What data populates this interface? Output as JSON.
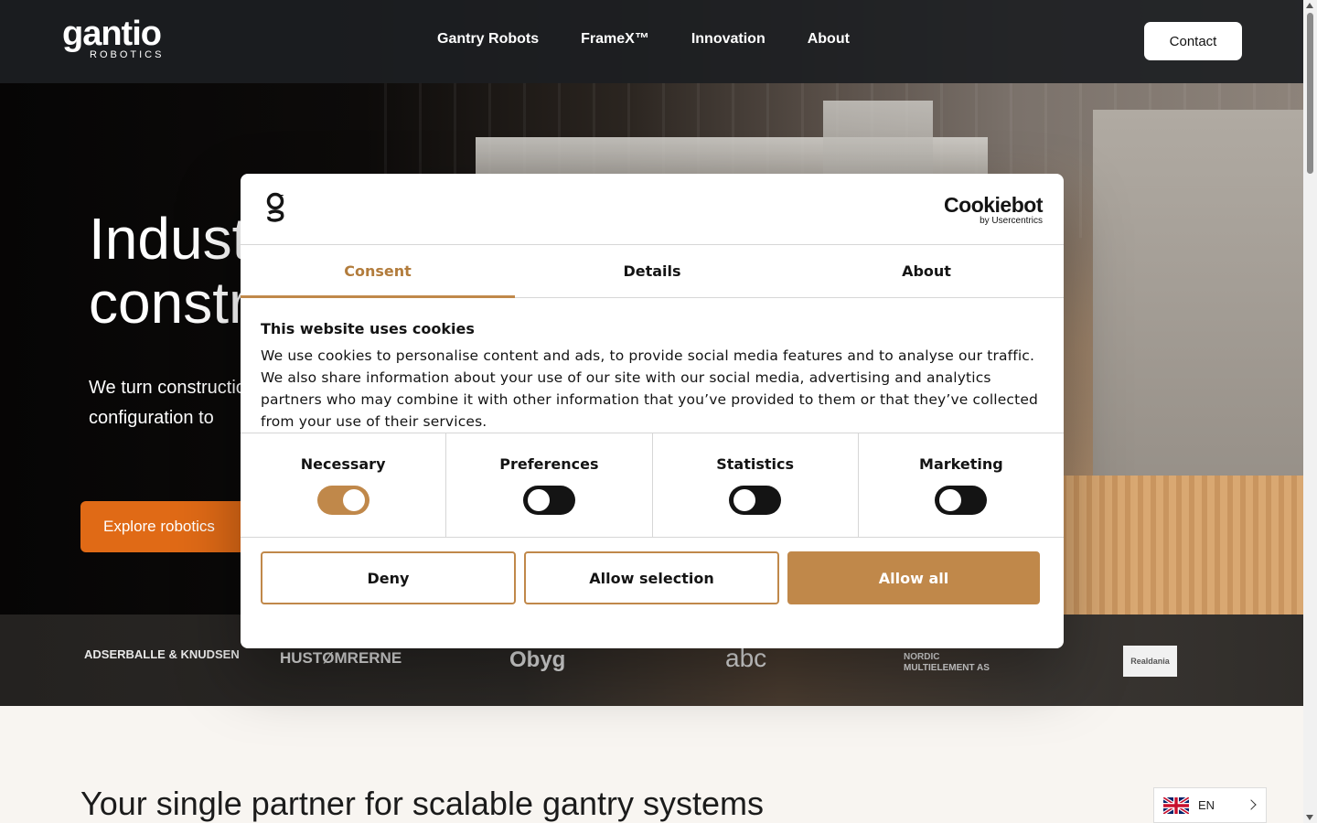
{
  "header": {
    "logo_word": "gantio",
    "logo_sub": "ROBOTICS",
    "nav": [
      "Gantry Robots",
      "FrameX™",
      "Innovation",
      "About"
    ],
    "contact_label": "Contact"
  },
  "hero": {
    "title": "Industrial\nconstruction",
    "subtitle": "We turn construction into scalable, automated configuration to",
    "cta_label": "Explore robotics"
  },
  "partners": [
    "ADSERBALLE & KNUDSEN",
    "HUSTØMRERNE",
    "Obyg",
    "abc",
    "NORDIC MULTIELEMENT AS",
    "Realdania"
  ],
  "section": {
    "title": "Your single partner for scalable gantry systems"
  },
  "language": {
    "code": "EN"
  },
  "cookie_dialog": {
    "brand": "Cookiebot",
    "brand_sub": "by Usercentrics",
    "tabs": [
      "Consent",
      "Details",
      "About"
    ],
    "active_tab": "Consent",
    "title": "This website uses cookies",
    "text": "We use cookies to personalise content and ads, to provide social media features and to analyse our traffic. We also share information about your use of our site with our social media, advertising and analytics partners who may combine it with other information that you’ve provided to them or that they’ve collected from your use of their services.",
    "categories": [
      {
        "label": "Necessary",
        "enabled": true
      },
      {
        "label": "Preferences",
        "enabled": false
      },
      {
        "label": "Statistics",
        "enabled": false
      },
      {
        "label": "Marketing",
        "enabled": false
      }
    ],
    "buttons": {
      "deny": "Deny",
      "allow_selection": "Allow selection",
      "allow_all": "Allow all"
    },
    "accent_color": "#c0884a"
  }
}
